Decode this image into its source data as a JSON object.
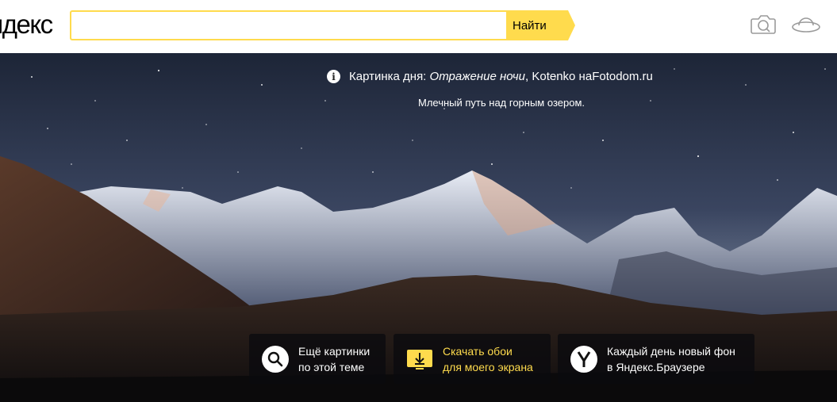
{
  "header": {
    "logo": "ндекс",
    "search": {
      "value": "",
      "placeholder": ""
    },
    "search_button_label": "Найти",
    "colors": {
      "accent": "#ffdb4d"
    },
    "icons": [
      "camera-icon",
      "ufo-icon"
    ]
  },
  "hero": {
    "caption": {
      "prefix": "Картинка дня:",
      "title": "Отражение ночи",
      "author": ", Kotenko на ",
      "source": "Fotodom.ru"
    },
    "subcaption": "Млечный путь над горным озером.",
    "cards": [
      {
        "line1": "Ещё картинки",
        "line2": "по этой теме",
        "icon": "search-icon"
      },
      {
        "line1": "Скачать обои",
        "line2": "для моего экрана",
        "icon": "download-icon"
      },
      {
        "line1": "Каждый день новый фон",
        "line2": "в Яндекс.Браузере",
        "icon": "yandex-browser-icon"
      }
    ]
  }
}
